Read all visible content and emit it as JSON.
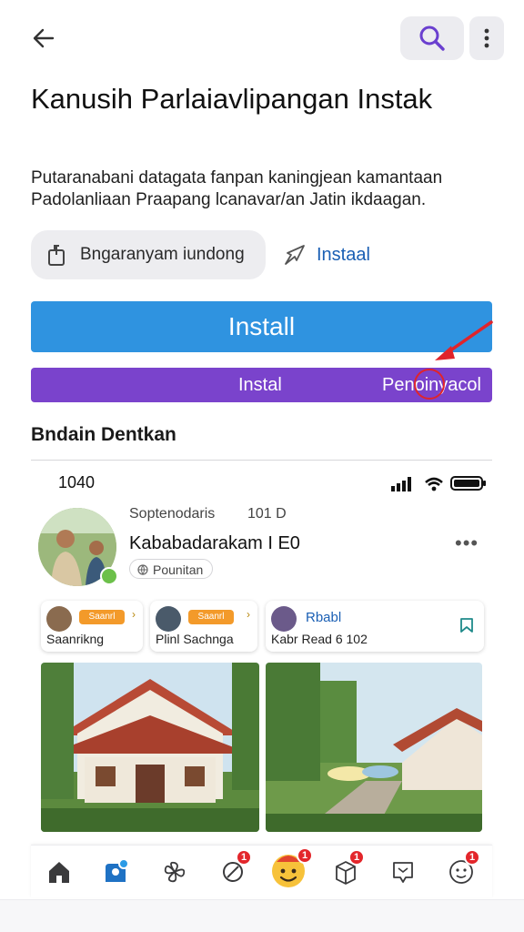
{
  "header": {
    "back_icon": "arrow-left-icon",
    "search_icon": "search-icon",
    "more_icon": "kebab-menu-icon",
    "accent": "#6a3fcf"
  },
  "title": "Kanusih Parlaiavlipangan Instak",
  "description": "Putaranabani datagata fanpan kaningjean kamantaan Padolanliaan Praapang lcanavar/an Jatin ikdaagan.",
  "actions": {
    "pill_label": "Bngaranyam iundong",
    "pill_icon": "share-box-icon",
    "link_label": "Instaal",
    "link_icon": "share-arrow-icon"
  },
  "install": {
    "main_label": "Install",
    "main_color": "#2f93e0",
    "bar_left_label": "Instal",
    "bar_right_label": "Penoinyacol",
    "bar_color": "#7a43cc"
  },
  "section": {
    "heading": "Bndain Dentkan"
  },
  "preview": {
    "status_time": "1040",
    "post": {
      "meta_left": "Soptenodaris",
      "meta_right": "101 D",
      "author": "Kababadarakam I E0",
      "tag": "Pounitan",
      "more": "•••"
    },
    "mini_cards": [
      {
        "badge": "Saanrl",
        "sub": "Saanrikng",
        "caret": "›"
      },
      {
        "badge": "Saanrl",
        "sub": "Plinl Sachnga",
        "caret": "›"
      },
      {
        "title": "Rbabl",
        "sub": "Kabr Read 6 102",
        "icon": "bookmark-icon"
      }
    ]
  },
  "nav": {
    "items": [
      {
        "icon": "home-icon",
        "badge": ""
      },
      {
        "icon": "profile-icon",
        "badge": ""
      },
      {
        "icon": "pinwheel-icon",
        "badge": ""
      },
      {
        "icon": "leaf-icon",
        "badge": "1"
      },
      {
        "icon": "emoji-face-icon",
        "badge": "1"
      },
      {
        "icon": "box-icon",
        "badge": "1"
      },
      {
        "icon": "chat-bubble-icon",
        "badge": ""
      },
      {
        "icon": "smiley-icon",
        "badge": "1"
      }
    ]
  }
}
